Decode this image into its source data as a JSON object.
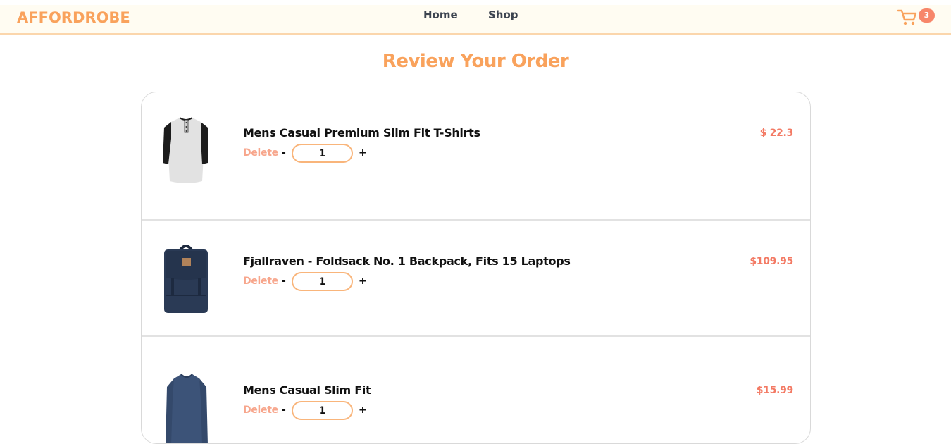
{
  "header": {
    "logo": "AFFORDROBE",
    "nav": {
      "home": "Home",
      "shop": "Shop"
    },
    "cart_count": "3"
  },
  "page_title": "Review Your Order",
  "items": [
    {
      "name": "Mens Casual Premium Slim Fit T-Shirts",
      "price": "$ 22.3",
      "delete_label": "Delete",
      "minus": "-",
      "plus": "+",
      "quantity": "1"
    },
    {
      "name": "Fjallraven - Foldsack No. 1 Backpack, Fits 15 Laptops",
      "price": "$109.95",
      "delete_label": "Delete",
      "minus": "-",
      "plus": "+",
      "quantity": "1"
    },
    {
      "name": "Mens Casual Slim Fit",
      "price": "$15.99",
      "delete_label": "Delete",
      "minus": "-",
      "plus": "+",
      "quantity": "1"
    }
  ],
  "colors": {
    "accent": "#f9a25c",
    "price": "#f37a64",
    "delete": "#f7a68c",
    "header_bg": "#fffcf2"
  }
}
